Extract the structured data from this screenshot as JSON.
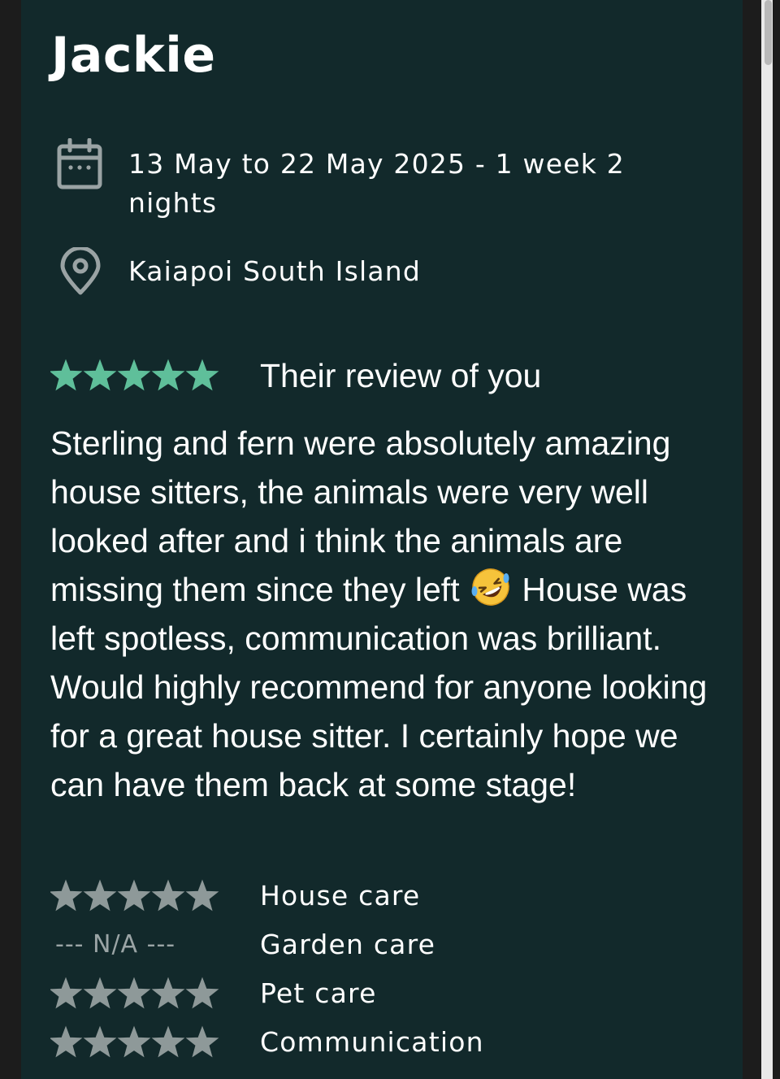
{
  "profile": {
    "name": "Jackie"
  },
  "stay": {
    "dates_icon": "calendar-icon",
    "dates": "13 May to 22 May 2025 - 1 week 2 nights",
    "location_icon": "map-pin-icon",
    "location": "Kaiapoi South Island"
  },
  "review": {
    "overall_stars": 5,
    "heading": "Their review of you",
    "text_before_emoji": "Sterling and fern were absolutely amazing house sitters, the animals were very well looked after and i think the animals are missing them since they left",
    "emoji": "rolling-on-floor-laughing-emoji",
    "text_after_emoji": "House was left spotless, communication was brilliant. Would highly recommend for anyone looking for a great house sitter. I certainly hope we can have them back at some stage!"
  },
  "ratings": [
    {
      "label": "House care",
      "stars": 5
    },
    {
      "label": "Garden care",
      "value": "--- N/A ---"
    },
    {
      "label": "Pet care",
      "stars": 5
    },
    {
      "label": "Communication",
      "stars": 5
    }
  ],
  "colors": {
    "card_background": "#12292b",
    "page_background": "#1c1c1c",
    "overall_star": "#5fbf9a",
    "category_star": "#8e9999",
    "icon_gray": "#9aa3a4",
    "text": "#ffffff"
  }
}
